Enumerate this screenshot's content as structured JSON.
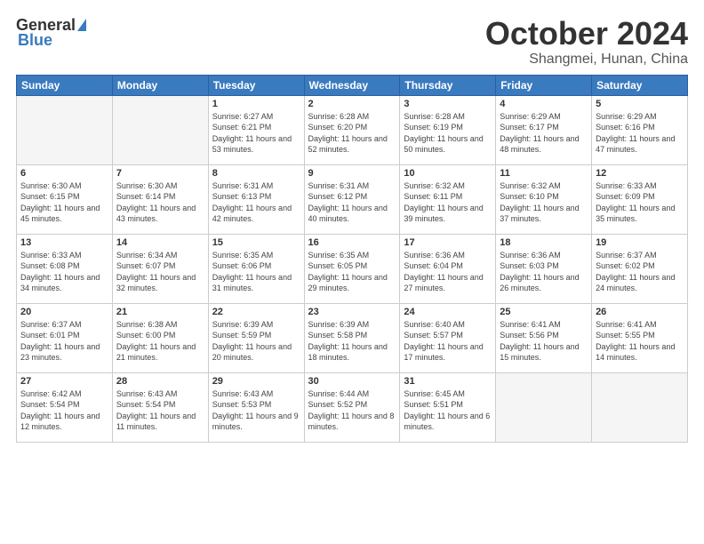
{
  "header": {
    "logo_general": "General",
    "logo_blue": "Blue",
    "month": "October 2024",
    "location": "Shangmei, Hunan, China"
  },
  "weekdays": [
    "Sunday",
    "Monday",
    "Tuesday",
    "Wednesday",
    "Thursday",
    "Friday",
    "Saturday"
  ],
  "weeks": [
    [
      {
        "day": "",
        "info": ""
      },
      {
        "day": "",
        "info": ""
      },
      {
        "day": "1",
        "info": "Sunrise: 6:27 AM\nSunset: 6:21 PM\nDaylight: 11 hours and 53 minutes."
      },
      {
        "day": "2",
        "info": "Sunrise: 6:28 AM\nSunset: 6:20 PM\nDaylight: 11 hours and 52 minutes."
      },
      {
        "day": "3",
        "info": "Sunrise: 6:28 AM\nSunset: 6:19 PM\nDaylight: 11 hours and 50 minutes."
      },
      {
        "day": "4",
        "info": "Sunrise: 6:29 AM\nSunset: 6:17 PM\nDaylight: 11 hours and 48 minutes."
      },
      {
        "day": "5",
        "info": "Sunrise: 6:29 AM\nSunset: 6:16 PM\nDaylight: 11 hours and 47 minutes."
      }
    ],
    [
      {
        "day": "6",
        "info": "Sunrise: 6:30 AM\nSunset: 6:15 PM\nDaylight: 11 hours and 45 minutes."
      },
      {
        "day": "7",
        "info": "Sunrise: 6:30 AM\nSunset: 6:14 PM\nDaylight: 11 hours and 43 minutes."
      },
      {
        "day": "8",
        "info": "Sunrise: 6:31 AM\nSunset: 6:13 PM\nDaylight: 11 hours and 42 minutes."
      },
      {
        "day": "9",
        "info": "Sunrise: 6:31 AM\nSunset: 6:12 PM\nDaylight: 11 hours and 40 minutes."
      },
      {
        "day": "10",
        "info": "Sunrise: 6:32 AM\nSunset: 6:11 PM\nDaylight: 11 hours and 39 minutes."
      },
      {
        "day": "11",
        "info": "Sunrise: 6:32 AM\nSunset: 6:10 PM\nDaylight: 11 hours and 37 minutes."
      },
      {
        "day": "12",
        "info": "Sunrise: 6:33 AM\nSunset: 6:09 PM\nDaylight: 11 hours and 35 minutes."
      }
    ],
    [
      {
        "day": "13",
        "info": "Sunrise: 6:33 AM\nSunset: 6:08 PM\nDaylight: 11 hours and 34 minutes."
      },
      {
        "day": "14",
        "info": "Sunrise: 6:34 AM\nSunset: 6:07 PM\nDaylight: 11 hours and 32 minutes."
      },
      {
        "day": "15",
        "info": "Sunrise: 6:35 AM\nSunset: 6:06 PM\nDaylight: 11 hours and 31 minutes."
      },
      {
        "day": "16",
        "info": "Sunrise: 6:35 AM\nSunset: 6:05 PM\nDaylight: 11 hours and 29 minutes."
      },
      {
        "day": "17",
        "info": "Sunrise: 6:36 AM\nSunset: 6:04 PM\nDaylight: 11 hours and 27 minutes."
      },
      {
        "day": "18",
        "info": "Sunrise: 6:36 AM\nSunset: 6:03 PM\nDaylight: 11 hours and 26 minutes."
      },
      {
        "day": "19",
        "info": "Sunrise: 6:37 AM\nSunset: 6:02 PM\nDaylight: 11 hours and 24 minutes."
      }
    ],
    [
      {
        "day": "20",
        "info": "Sunrise: 6:37 AM\nSunset: 6:01 PM\nDaylight: 11 hours and 23 minutes."
      },
      {
        "day": "21",
        "info": "Sunrise: 6:38 AM\nSunset: 6:00 PM\nDaylight: 11 hours and 21 minutes."
      },
      {
        "day": "22",
        "info": "Sunrise: 6:39 AM\nSunset: 5:59 PM\nDaylight: 11 hours and 20 minutes."
      },
      {
        "day": "23",
        "info": "Sunrise: 6:39 AM\nSunset: 5:58 PM\nDaylight: 11 hours and 18 minutes."
      },
      {
        "day": "24",
        "info": "Sunrise: 6:40 AM\nSunset: 5:57 PM\nDaylight: 11 hours and 17 minutes."
      },
      {
        "day": "25",
        "info": "Sunrise: 6:41 AM\nSunset: 5:56 PM\nDaylight: 11 hours and 15 minutes."
      },
      {
        "day": "26",
        "info": "Sunrise: 6:41 AM\nSunset: 5:55 PM\nDaylight: 11 hours and 14 minutes."
      }
    ],
    [
      {
        "day": "27",
        "info": "Sunrise: 6:42 AM\nSunset: 5:54 PM\nDaylight: 11 hours and 12 minutes."
      },
      {
        "day": "28",
        "info": "Sunrise: 6:43 AM\nSunset: 5:54 PM\nDaylight: 11 hours and 11 minutes."
      },
      {
        "day": "29",
        "info": "Sunrise: 6:43 AM\nSunset: 5:53 PM\nDaylight: 11 hours and 9 minutes."
      },
      {
        "day": "30",
        "info": "Sunrise: 6:44 AM\nSunset: 5:52 PM\nDaylight: 11 hours and 8 minutes."
      },
      {
        "day": "31",
        "info": "Sunrise: 6:45 AM\nSunset: 5:51 PM\nDaylight: 11 hours and 6 minutes."
      },
      {
        "day": "",
        "info": ""
      },
      {
        "day": "",
        "info": ""
      }
    ]
  ]
}
